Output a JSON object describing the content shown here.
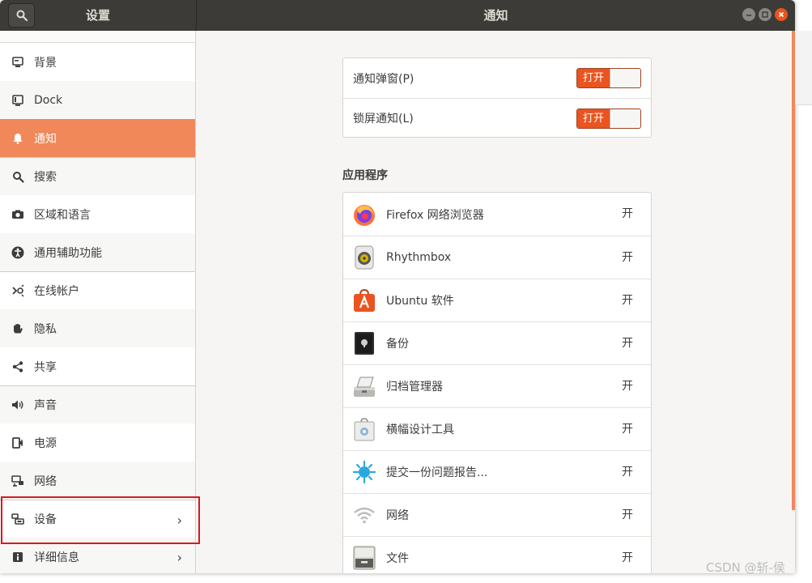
{
  "window": {
    "sidebar_title": "设置",
    "title": "通知"
  },
  "sidebar": {
    "items": [
      {
        "label": "背景",
        "icon": "background-icon"
      },
      {
        "label": "Dock",
        "icon": "dock-icon"
      },
      {
        "label": "通知",
        "icon": "bell-icon",
        "active": true
      },
      {
        "label": "搜索",
        "icon": "search-icon"
      },
      {
        "label": "区域和语言",
        "icon": "camera-icon"
      },
      {
        "label": "通用辅助功能",
        "icon": "accessibility-icon"
      },
      {
        "label": "在线帐户",
        "icon": "online-accounts-icon"
      },
      {
        "label": "隐私",
        "icon": "hand-icon"
      },
      {
        "label": "共享",
        "icon": "share-icon"
      },
      {
        "label": "声音",
        "icon": "speaker-icon"
      },
      {
        "label": "电源",
        "icon": "power-icon"
      },
      {
        "label": "网络",
        "icon": "network-icon"
      },
      {
        "label": "设备",
        "icon": "devices-icon",
        "chevron": "›"
      },
      {
        "label": "详细信息",
        "icon": "info-icon",
        "chevron": "›"
      }
    ]
  },
  "notifications": {
    "popups_label": "通知弹窗(P)",
    "lock_screen_label": "锁屏通知(L)",
    "switch_on_label": "打开",
    "popups_on": true,
    "lock_screen_on": true
  },
  "apps": {
    "section_title": "应用程序",
    "items": [
      {
        "name": "Firefox 网络浏览器",
        "state": "开",
        "icon": "firefox-icon"
      },
      {
        "name": "Rhythmbox",
        "state": "开",
        "icon": "rhythmbox-icon"
      },
      {
        "name": "Ubuntu 软件",
        "state": "开",
        "icon": "ubuntu-software-icon"
      },
      {
        "name": "备份",
        "state": "开",
        "icon": "backup-icon"
      },
      {
        "name": "归档管理器",
        "state": "开",
        "icon": "archive-manager-icon"
      },
      {
        "name": "横幅设计工具",
        "state": "开",
        "icon": "banner-designer-icon"
      },
      {
        "name": "提交一份问题报告...",
        "state": "开",
        "icon": "bug-report-icon"
      },
      {
        "name": "网络",
        "state": "开",
        "icon": "wifi-icon"
      },
      {
        "name": "文件",
        "state": "开",
        "icon": "files-icon"
      }
    ]
  },
  "watermark": "CSDN @斩-侯",
  "colors": {
    "accent": "#e95420",
    "sidebar_active": "#f0885a",
    "headerbar": "#3c3b37",
    "highlight_box": "#d9191c"
  }
}
